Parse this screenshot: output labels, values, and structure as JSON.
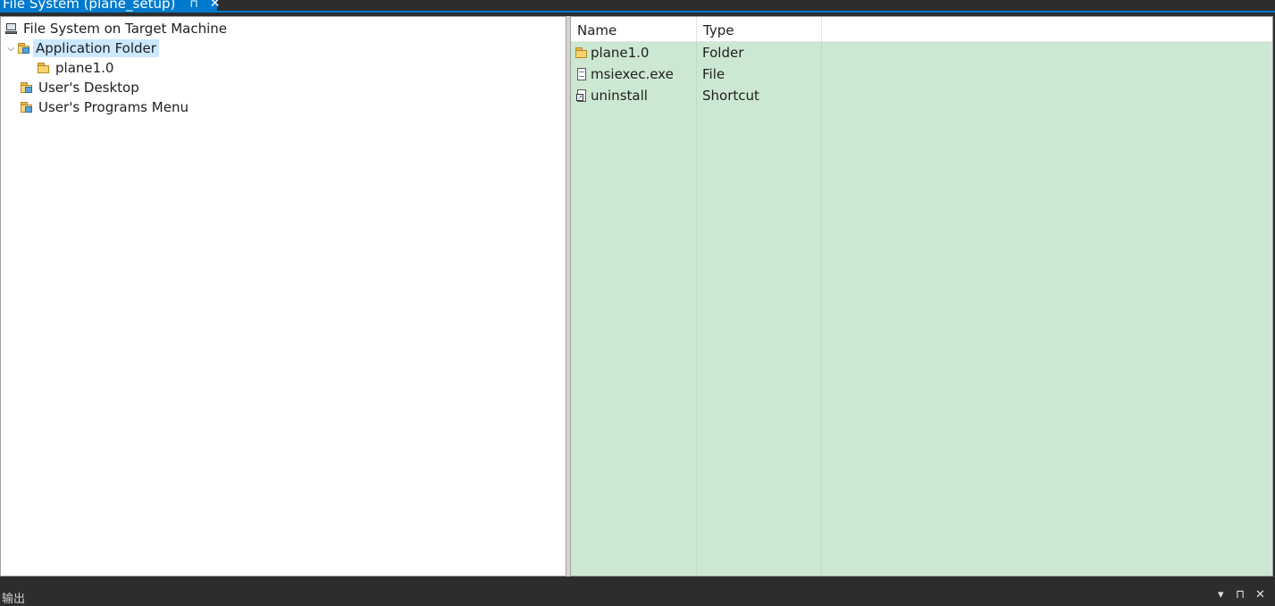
{
  "tab": {
    "title": "File System (plane_setup)",
    "pin_glyph": "⊓",
    "close_glyph": "✕"
  },
  "tree": {
    "root_label": "File System on Target Machine",
    "items": [
      {
        "label": "Application Folder",
        "expanded": true,
        "selected": true,
        "icon": "folder-open-icon"
      },
      {
        "label": "plane1.0",
        "icon": "folder-icon"
      },
      {
        "label": "User's Desktop",
        "icon": "folder-open-icon"
      },
      {
        "label": "User's Programs Menu",
        "icon": "folder-open-icon"
      }
    ]
  },
  "list": {
    "columns": [
      "Name",
      "Type"
    ],
    "rows": [
      {
        "name": "plane1.0",
        "type": "Folder",
        "icon": "folder-icon"
      },
      {
        "name": "msiexec.exe",
        "type": "File",
        "icon": "file-icon"
      },
      {
        "name": "uninstall",
        "type": "Shortcut",
        "icon": "shortcut-icon"
      }
    ]
  },
  "output_panel": {
    "title": "输出",
    "dropdown_glyph": "▾",
    "pin_glyph": "⊓",
    "close_glyph": "✕"
  },
  "colors": {
    "accent": "#007acc",
    "list_background": "#cde8d2",
    "selection": "#cce8ff",
    "chrome": "#2d2d30"
  }
}
